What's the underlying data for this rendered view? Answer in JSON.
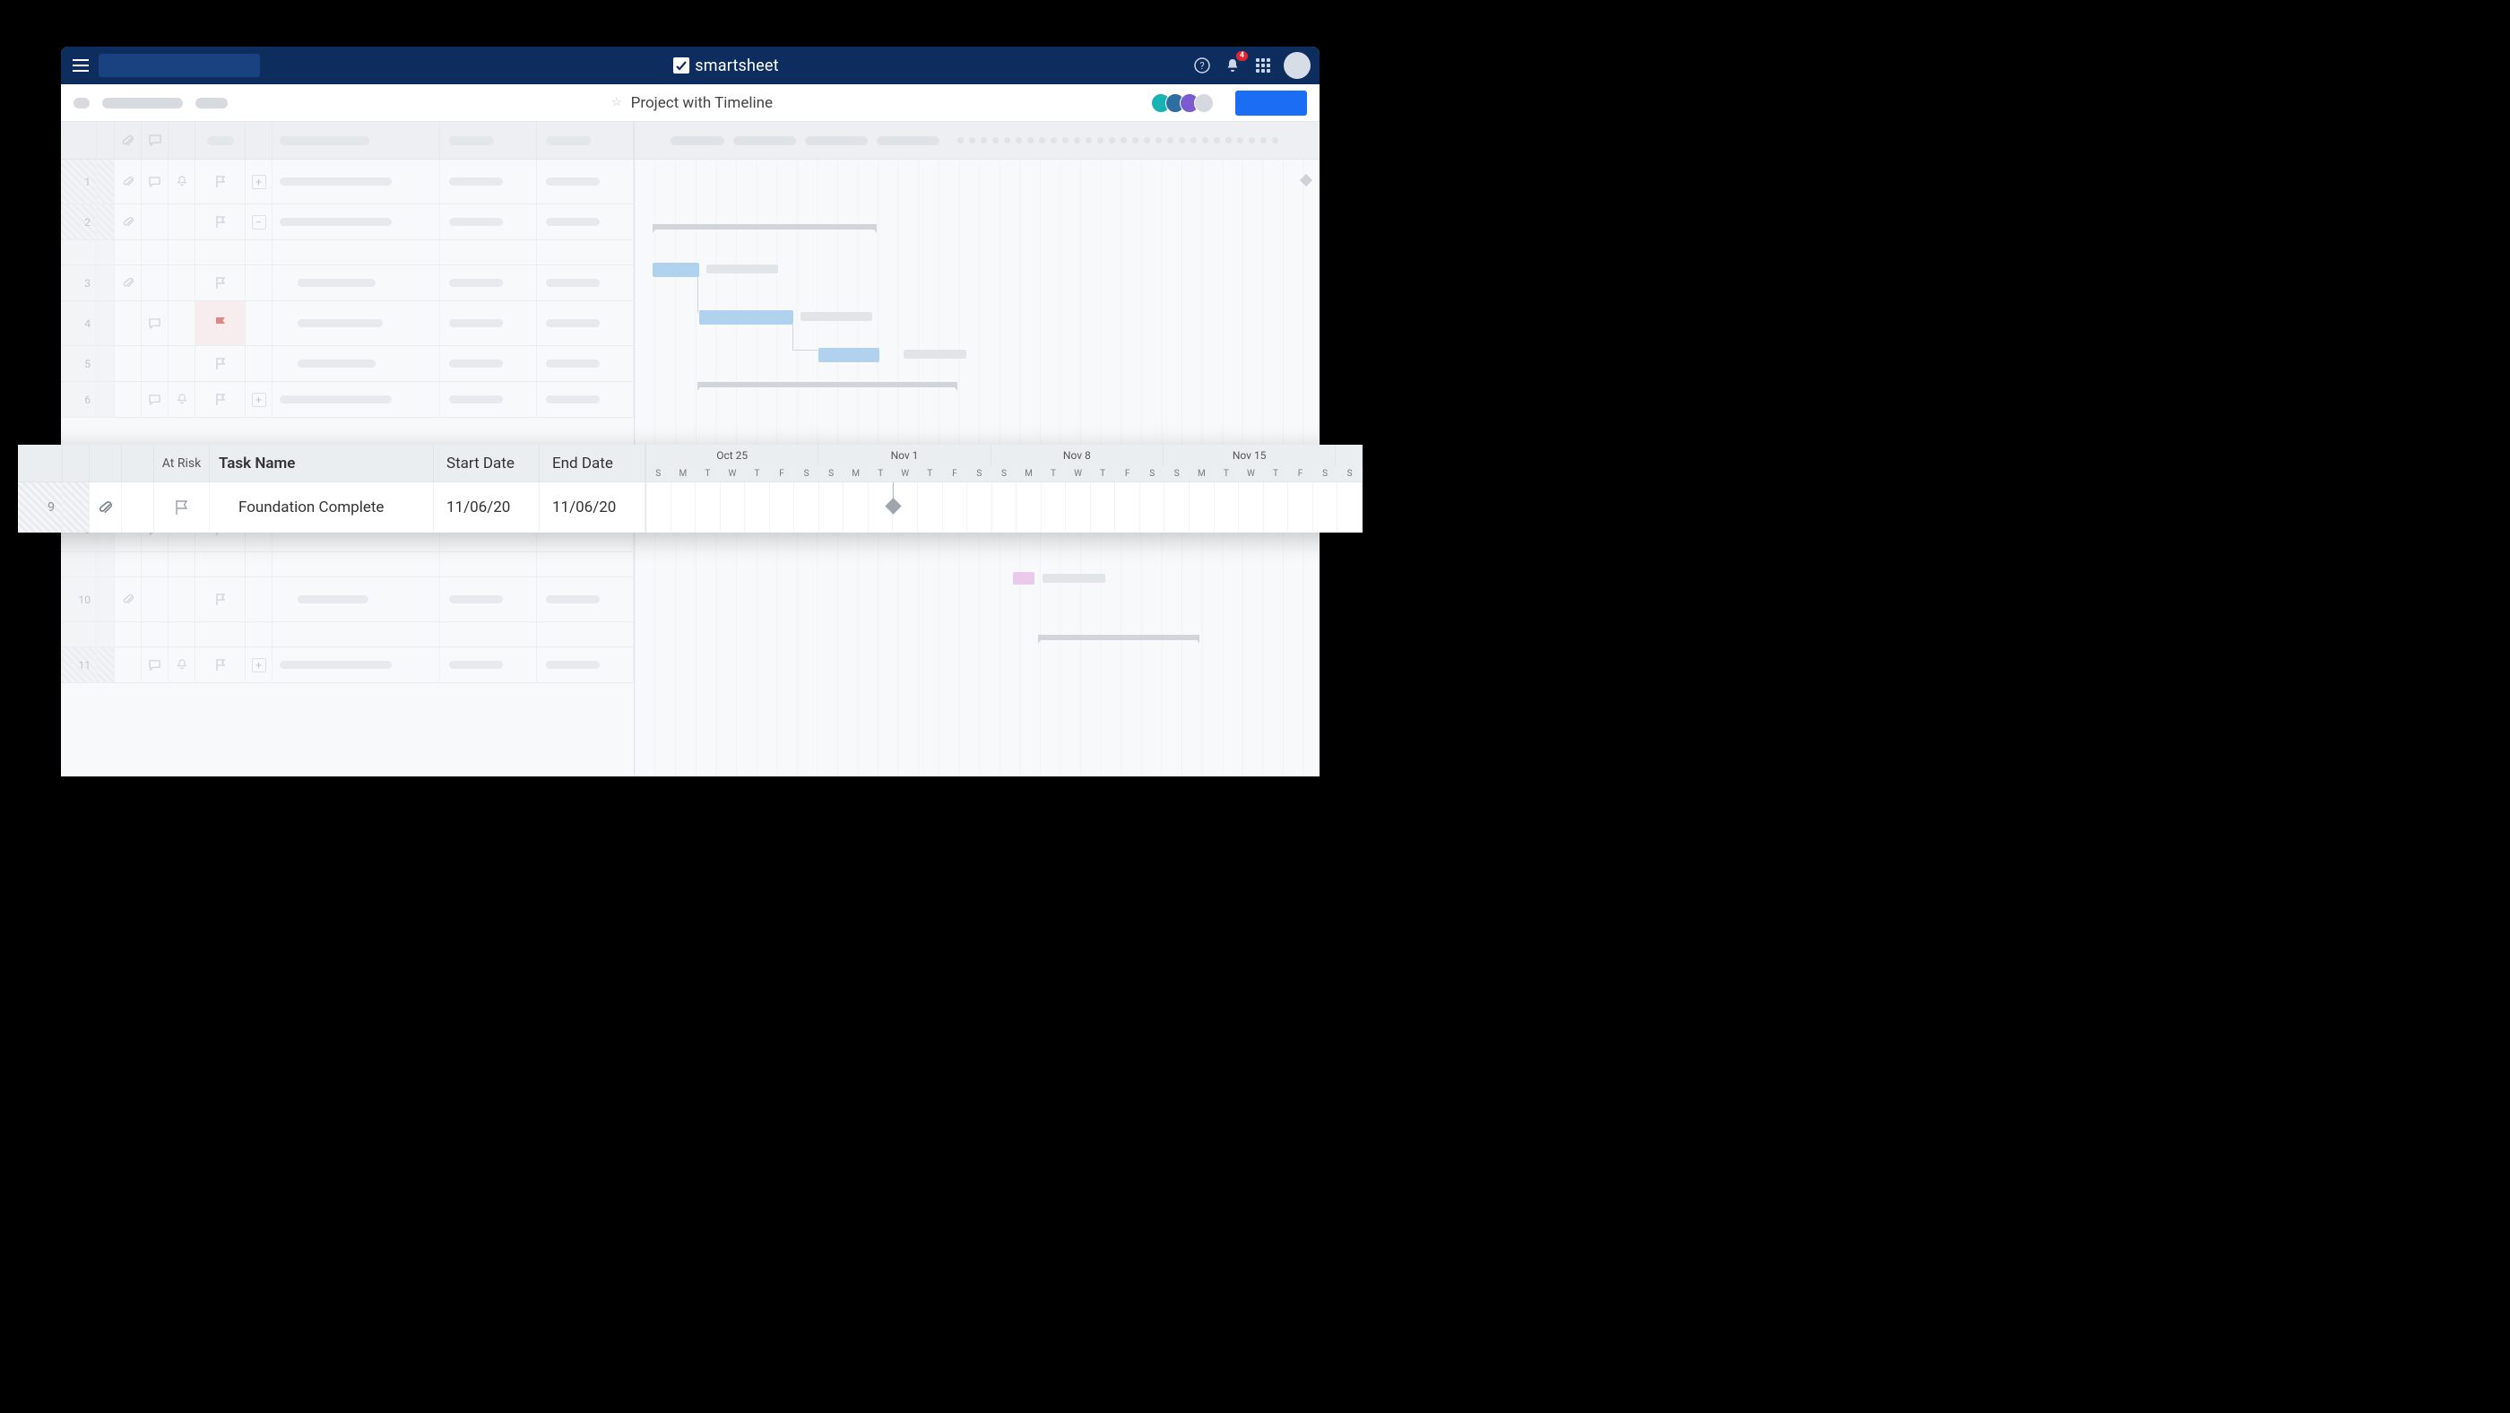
{
  "brand": "smartsheet",
  "notification_count": "4",
  "sheet_title": "Project with Timeline",
  "columns": {
    "at_risk": "At Risk",
    "task_name": "Task Name",
    "start_date": "Start Date",
    "end_date": "End Date"
  },
  "timeline_weeks": [
    "Oct 25",
    "Nov 1",
    "Nov 8",
    "Nov 15"
  ],
  "timeline_days": [
    "S",
    "M",
    "T",
    "W",
    "T",
    "F",
    "S",
    "S",
    "M",
    "T",
    "W",
    "T",
    "F",
    "S",
    "S",
    "M",
    "T",
    "W",
    "T",
    "F",
    "S",
    "S",
    "M",
    "T",
    "W",
    "T",
    "F",
    "S",
    "S"
  ],
  "rows": {
    "r1": {
      "num": "1"
    },
    "r2": {
      "num": "2"
    },
    "r3": {
      "num": "3"
    },
    "r4": {
      "num": "4"
    },
    "r5": {
      "num": "5"
    },
    "r6": {
      "num": "6"
    },
    "r9": {
      "num": "9"
    },
    "r10": {
      "num": "10"
    },
    "r11": {
      "num": "11"
    }
  },
  "highlight_row": {
    "num": "9",
    "task_name": "Foundation Complete",
    "start_date": "11/06/20",
    "end_date": "11/06/20"
  },
  "colors": {
    "navy": "#0d2d5e",
    "blue_accent": "#1b6ef3",
    "bar_blue": "#7fb8ec",
    "bar_pink": "#e6a9e6",
    "flag_red": "#d0302f"
  }
}
